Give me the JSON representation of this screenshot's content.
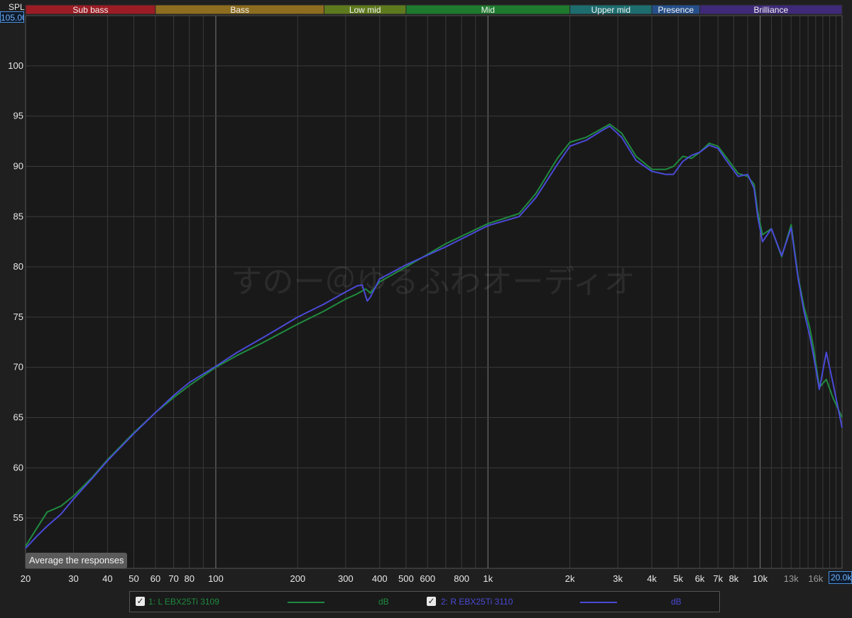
{
  "colors": {
    "background": "#1f1f1f",
    "plot_background": "#191919",
    "grid_major": "#6a6a6a",
    "grid_minor": "#3a3a3a",
    "left_trace": "#1f8a3f",
    "right_trace": "#4a4ad8"
  },
  "y_axis": {
    "title": "SPL",
    "top_value": "105.00"
  },
  "x_axis": {
    "end_value": "20.0k"
  },
  "button": {
    "average_label": "Average the responses"
  },
  "watermark": "すのー＠ゆるふわオーディオ",
  "bands": [
    {
      "label": "Sub bass",
      "from": 20,
      "to": 60,
      "color": "#9b1c24"
    },
    {
      "label": "Bass",
      "from": 60,
      "to": 250,
      "color": "#8d6d1f"
    },
    {
      "label": "Low mid",
      "from": 250,
      "to": 500,
      "color": "#5e7a1e"
    },
    {
      "label": "Mid",
      "from": 500,
      "to": 2000,
      "color": "#1e7a2e"
    },
    {
      "label": "Upper mid",
      "from": 2000,
      "to": 4000,
      "color": "#1d6d6f"
    },
    {
      "label": "Presence",
      "from": 4000,
      "to": 6000,
      "color": "#264f8a"
    },
    {
      "label": "Brilliance",
      "from": 6000,
      "to": 20000,
      "color": "#3e2a78"
    }
  ],
  "legend": [
    {
      "check": "✓",
      "name": "1: L EBX25Ti 3109",
      "unit": "dB",
      "color": "#1f8a3f"
    },
    {
      "check": "✓",
      "name": "2: R EBX25Ti 3110",
      "unit": "dB",
      "color": "#4a4ad8"
    }
  ],
  "chart_data": {
    "type": "line",
    "xscale": "log",
    "xlim": [
      20,
      20000
    ],
    "ylim": [
      50,
      105
    ],
    "ylabel": "SPL",
    "grid": true,
    "x_ticks": [
      {
        "value": 20,
        "label": "20"
      },
      {
        "value": 30,
        "label": "30"
      },
      {
        "value": 40,
        "label": "40"
      },
      {
        "value": 50,
        "label": "50"
      },
      {
        "value": 60,
        "label": "60"
      },
      {
        "value": 70,
        "label": "70"
      },
      {
        "value": 80,
        "label": "80"
      },
      {
        "value": 100,
        "label": "100"
      },
      {
        "value": 200,
        "label": "200"
      },
      {
        "value": 300,
        "label": "300"
      },
      {
        "value": 400,
        "label": "400"
      },
      {
        "value": 500,
        "label": "500"
      },
      {
        "value": 600,
        "label": "600"
      },
      {
        "value": 800,
        "label": "800"
      },
      {
        "value": 1000,
        "label": "1k"
      },
      {
        "value": 2000,
        "label": "2k"
      },
      {
        "value": 3000,
        "label": "3k"
      },
      {
        "value": 4000,
        "label": "4k"
      },
      {
        "value": 5000,
        "label": "5k"
      },
      {
        "value": 6000,
        "label": "6k"
      },
      {
        "value": 7000,
        "label": "7k"
      },
      {
        "value": 8000,
        "label": "8k"
      },
      {
        "value": 10000,
        "label": "10k"
      },
      {
        "value": 13000,
        "label": "13k",
        "dim": true
      },
      {
        "value": 16000,
        "label": "16k",
        "dim": true
      }
    ],
    "y_ticks": [
      55,
      60,
      65,
      70,
      75,
      80,
      85,
      90,
      95,
      100
    ],
    "series": [
      {
        "name": "1: L EBX25Ti 3109",
        "color": "#1f8a3f",
        "x": [
          20,
          22,
          24,
          27,
          30,
          35,
          40,
          50,
          60,
          70,
          80,
          100,
          120,
          150,
          200,
          250,
          300,
          330,
          355,
          370,
          400,
          500,
          700,
          1000,
          1300,
          1500,
          1800,
          2000,
          2300,
          2600,
          2800,
          3100,
          3500,
          4000,
          4500,
          4800,
          5200,
          5600,
          6000,
          6500,
          7000,
          7600,
          8300,
          9000,
          9500,
          9800,
          10200,
          11000,
          12000,
          13000,
          13800,
          14500,
          15200,
          15700,
          16500,
          17500,
          18500,
          20000
        ],
        "y": [
          52.2,
          54.0,
          55.6,
          56.2,
          57.2,
          59.0,
          60.8,
          63.5,
          65.5,
          67.0,
          68.2,
          70.0,
          71.2,
          72.5,
          74.3,
          75.6,
          76.8,
          77.3,
          77.8,
          77.4,
          78.5,
          80.0,
          82.3,
          84.3,
          85.3,
          87.3,
          90.8,
          92.4,
          92.9,
          93.7,
          94.2,
          93.3,
          91.0,
          89.7,
          89.7,
          90.0,
          91.0,
          90.8,
          91.4,
          92.3,
          92.0,
          90.7,
          89.3,
          89.0,
          88.2,
          85.5,
          83.2,
          83.8,
          81.0,
          84.2,
          79.0,
          76.0,
          74.0,
          72.0,
          68.0,
          68.8,
          67.0,
          65.0
        ]
      },
      {
        "name": "2: R EBX25Ti 3110",
        "color": "#4a4ad8",
        "x": [
          20,
          22,
          24,
          27,
          30,
          35,
          40,
          50,
          60,
          70,
          80,
          100,
          120,
          150,
          200,
          250,
          300,
          330,
          345,
          360,
          370,
          400,
          500,
          700,
          1000,
          1300,
          1500,
          1800,
          2000,
          2300,
          2600,
          2800,
          3100,
          3500,
          4000,
          4500,
          4800,
          5200,
          5600,
          6000,
          6500,
          7000,
          7600,
          8300,
          9000,
          9500,
          9800,
          10200,
          11000,
          12000,
          13000,
          13800,
          14500,
          15200,
          15700,
          16500,
          17500,
          18500,
          20000
        ],
        "y": [
          52.0,
          53.2,
          54.2,
          55.4,
          56.9,
          58.9,
          60.7,
          63.4,
          65.5,
          67.2,
          68.5,
          70.1,
          71.5,
          73.0,
          75.0,
          76.3,
          77.5,
          78.1,
          78.2,
          76.6,
          77.0,
          78.8,
          80.2,
          82.0,
          84.1,
          85.0,
          86.9,
          90.2,
          92.0,
          92.6,
          93.5,
          94.0,
          92.9,
          90.6,
          89.5,
          89.2,
          89.2,
          90.5,
          91.1,
          91.4,
          92.1,
          91.8,
          90.4,
          89.0,
          89.2,
          87.8,
          85.0,
          82.5,
          83.8,
          81.1,
          83.9,
          78.8,
          75.5,
          73.2,
          71.2,
          67.8,
          71.5,
          68.5,
          64.0
        ]
      }
    ]
  }
}
